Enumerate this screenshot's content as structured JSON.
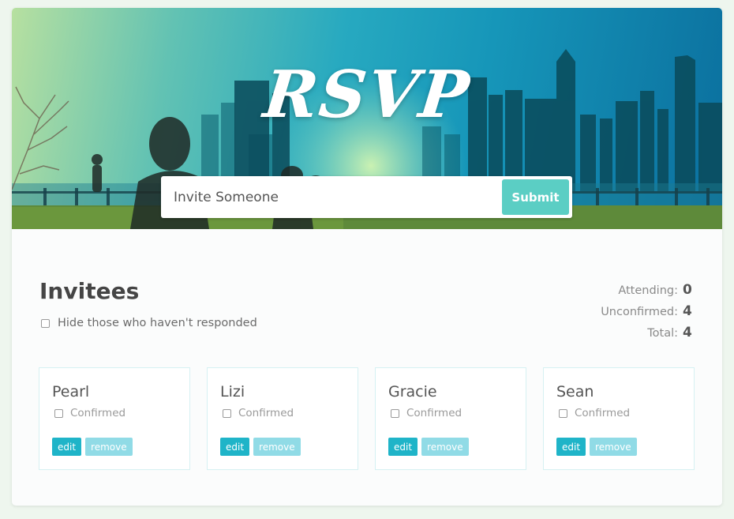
{
  "header": {
    "title": "RSVP",
    "input_placeholder": "Invite Someone",
    "submit_label": "Submit"
  },
  "invitees": {
    "title": "Invitees",
    "filter_label": "Hide those who haven't responded"
  },
  "stats": {
    "attending_label": "Attending:",
    "attending_value": "0",
    "unconfirmed_label": "Unconfirmed:",
    "unconfirmed_value": "4",
    "total_label": "Total:",
    "total_value": "4"
  },
  "guests": [
    {
      "name": "Pearl",
      "confirmed_label": "Confirmed",
      "edit_label": "edit",
      "remove_label": "remove"
    },
    {
      "name": "Lizi",
      "confirmed_label": "Confirmed",
      "edit_label": "edit",
      "remove_label": "remove"
    },
    {
      "name": "Gracie",
      "confirmed_label": "Confirmed",
      "edit_label": "edit",
      "remove_label": "remove"
    },
    {
      "name": "Sean",
      "confirmed_label": "Confirmed",
      "edit_label": "edit",
      "remove_label": "remove"
    }
  ],
  "colors": {
    "accent": "#1fb4c8",
    "accent_light": "#90dbe6",
    "submit": "#5bcec4"
  }
}
